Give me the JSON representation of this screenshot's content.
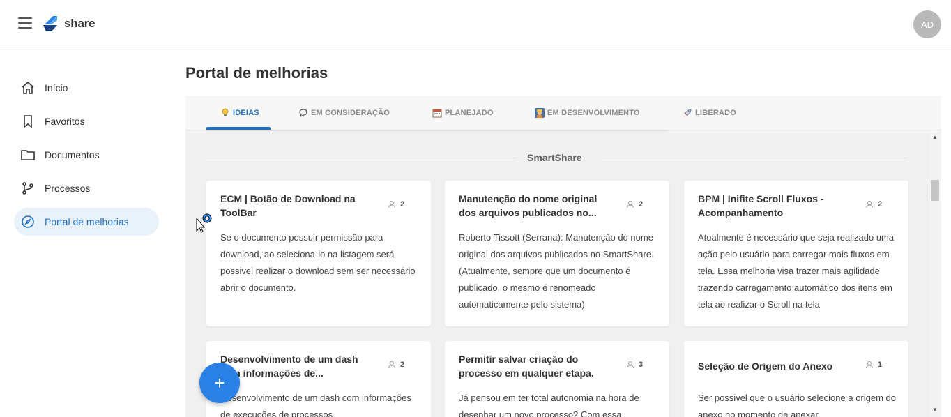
{
  "app": {
    "brand": "share",
    "avatar_initials": "AD"
  },
  "sidebar": {
    "items": [
      {
        "label": "Início",
        "icon": "home-icon"
      },
      {
        "label": "Favoritos",
        "icon": "bookmark-icon"
      },
      {
        "label": "Documentos",
        "icon": "folder-icon"
      },
      {
        "label": "Processos",
        "icon": "branch-icon"
      },
      {
        "label": "Portal de melhorias",
        "icon": "compass-icon",
        "active": true
      }
    ]
  },
  "main": {
    "title": "Portal de melhorias",
    "tabs": [
      {
        "label": "IDEIAS",
        "icon": "lightbulb-icon",
        "active": true
      },
      {
        "label": "EM CONSIDERAÇÃO",
        "icon": "chat-icon"
      },
      {
        "label": "PLANEJADO",
        "icon": "calendar-icon"
      },
      {
        "label": "EM DESENVOLVIMENTO",
        "icon": "worker-icon"
      },
      {
        "label": "LIBERADO",
        "icon": "rocket-icon"
      }
    ],
    "section_title": "SmartShare",
    "cards": [
      {
        "title": "ECM | Botão de Download na ToolBar",
        "votes": "2",
        "description": "Se o documento possuir permissão para download, ao seleciona-lo na listagem será possivel realizar o download sem ser necessário abrir o documento."
      },
      {
        "title": "Manutenção do nome original dos arquivos publicados no...",
        "votes": "2",
        "description": "Roberto Tissott (Serrana): Manutenção do nome original dos arquivos publicados no SmartShare. (Atualmente, sempre que um documento é publicado, o mesmo é renomeado automaticamente pelo sistema)"
      },
      {
        "title": "BPM | Inifite Scroll Fluxos - Acompanhamento",
        "votes": "2",
        "description": "Atualmente é necessário que seja realizado uma ação pelo usuário para carregar mais fluxos em tela. Essa melhoria visa trazer mais agilidade trazendo carregamento automático dos itens em tela ao realizar o Scroll na tela"
      },
      {
        "title": "Desenvolvimento de um dash com informações de...",
        "votes": "2",
        "description": "Desenvolvimento de um dash com informações de execuções de processos"
      },
      {
        "title": "Permitir salvar criação do processo em qualquer etapa.",
        "votes": "3",
        "description": "Já pensou em ter total autonomia na hora de desenhar um novo processo? Com essa"
      },
      {
        "title": "Seleção de Origem do Anexo",
        "votes": "1",
        "description": "Ser possivel que o usuário selecione a origem do anexo no momento de anexar"
      }
    ],
    "fab_label": "+"
  },
  "colors": {
    "accent": "#1f6fc4",
    "fab": "#2a80e4",
    "active_bg": "#e9f2fb",
    "content_bg": "#f0f0f0"
  }
}
